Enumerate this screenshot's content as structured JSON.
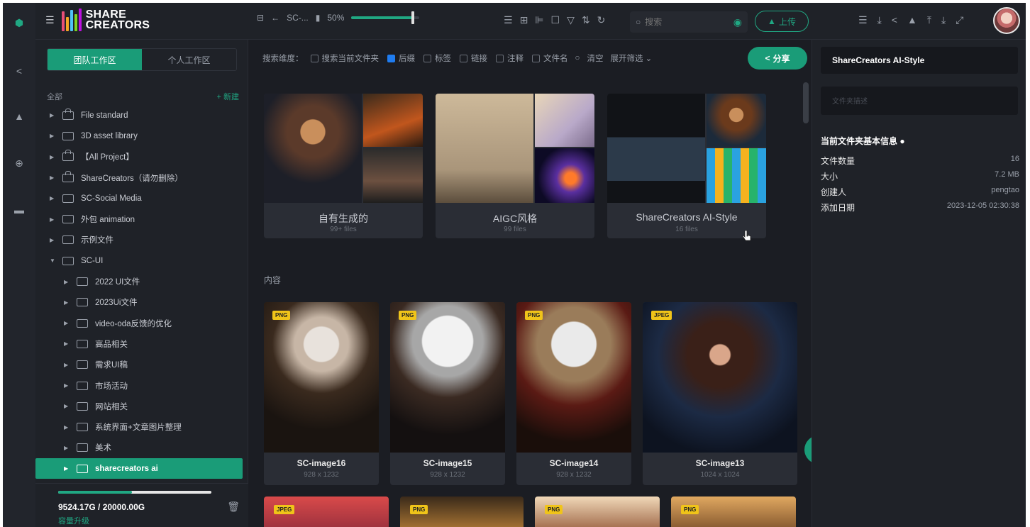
{
  "app": {
    "brand_line1": "SHARE",
    "brand_line2": "CREATORS"
  },
  "toolbar": {
    "crumb": "SC-...",
    "zoom": "50%",
    "zoom_level": 0.9,
    "search_placeholder": "搜索",
    "upload_label": "上传"
  },
  "workspace_tabs": [
    "团队工作区",
    "个人工作区"
  ],
  "tree": {
    "all_label": "全部",
    "new_label": "+ 新建",
    "items": [
      {
        "label": "File standard",
        "level": 0,
        "lock": true,
        "expanded": false
      },
      {
        "label": "3D asset library",
        "level": 0,
        "lock": false,
        "expanded": false
      },
      {
        "label": "【All Project】",
        "level": 0,
        "lock": true,
        "expanded": false
      },
      {
        "label": "ShareCreators（请勿删除）",
        "level": 0,
        "lock": true,
        "expanded": false
      },
      {
        "label": "SC-Social Media",
        "level": 0,
        "lock": false,
        "expanded": false
      },
      {
        "label": "外包 animation",
        "level": 0,
        "lock": false,
        "expanded": false
      },
      {
        "label": "示例文件",
        "level": 0,
        "lock": false,
        "expanded": false
      },
      {
        "label": "SC-UI",
        "level": 0,
        "lock": false,
        "expanded": true
      },
      {
        "label": "2022 UI文件",
        "level": 1,
        "lock": false,
        "expanded": false
      },
      {
        "label": "2023Ui文件",
        "level": 1,
        "lock": false,
        "expanded": false
      },
      {
        "label": "video-oda反馈的优化",
        "level": 1,
        "lock": false,
        "expanded": false
      },
      {
        "label": "高品相关",
        "level": 1,
        "lock": false,
        "expanded": false
      },
      {
        "label": "需求UI稿",
        "level": 1,
        "lock": false,
        "expanded": false
      },
      {
        "label": "市场活动",
        "level": 1,
        "lock": false,
        "expanded": false
      },
      {
        "label": "网站相关",
        "level": 1,
        "lock": false,
        "expanded": false
      },
      {
        "label": "系统界面+文章图片整理",
        "level": 1,
        "lock": false,
        "expanded": false
      },
      {
        "label": "美术",
        "level": 1,
        "lock": false,
        "expanded": false
      },
      {
        "label": "sharecreators ai",
        "level": 1,
        "lock": false,
        "expanded": false,
        "selected": true
      }
    ]
  },
  "storage": {
    "used_label": "9524.17G / 20000.00G",
    "fraction": 0.48,
    "upgrade_label": "容量升级"
  },
  "filters": {
    "label": "搜索维度：",
    "options": [
      {
        "label": "搜索当前文件夹",
        "checked": false
      },
      {
        "label": "后缀",
        "checked": true
      },
      {
        "label": "标签",
        "checked": false
      },
      {
        "label": "链接",
        "checked": false
      },
      {
        "label": "注释",
        "checked": false
      },
      {
        "label": "文件名",
        "checked": false
      }
    ],
    "clear_label": "清空",
    "expand_label": "展开筛选",
    "share_label": "分享"
  },
  "folders": [
    {
      "name": "自有生成的",
      "count": "99+ files"
    },
    {
      "name": "AIGC风格",
      "count": "99 files"
    },
    {
      "name": "ShareCreators AI-Style",
      "count": "16 files"
    }
  ],
  "section_label": "内容",
  "images": [
    {
      "badge": "PNG",
      "name": "SC-image16",
      "dims": "928 x 1232"
    },
    {
      "badge": "PNG",
      "name": "SC-image15",
      "dims": "928 x 1232"
    },
    {
      "badge": "PNG",
      "name": "SC-image14",
      "dims": "928 x 1232"
    },
    {
      "badge": "JPEG",
      "name": "SC-image13",
      "dims": "1024 x 1024"
    }
  ],
  "images_row2": [
    {
      "badge": "JPEG"
    },
    {
      "badge": "PNG"
    },
    {
      "badge": "PNG"
    },
    {
      "badge": "PNG"
    }
  ],
  "right_panel": {
    "title": "ShareCreators AI-Style",
    "desc_placeholder": "文件夹描述",
    "info_heading": "当前文件夹基本信息",
    "rows": [
      {
        "k": "文件数量",
        "v": "16"
      },
      {
        "k": "大小",
        "v": "7.2 MB"
      },
      {
        "k": "创建人",
        "v": "pengtao"
      },
      {
        "k": "添加日期",
        "v": "2023-12-05 02:30:38"
      }
    ]
  }
}
